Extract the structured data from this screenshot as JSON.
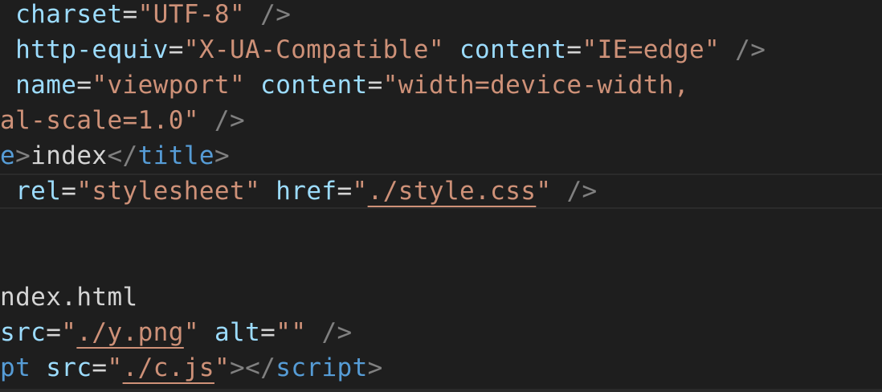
{
  "editor": {
    "lines": [
      [
        {
          "t": " "
        },
        {
          "t": "charset",
          "c": "attr"
        },
        {
          "t": "=",
          "c": "txt"
        },
        {
          "t": "\"UTF-8\"",
          "c": "str"
        },
        {
          "t": " "
        },
        {
          "t": "/>",
          "c": "punc"
        }
      ],
      [
        {
          "t": " "
        },
        {
          "t": "http-equiv",
          "c": "attr"
        },
        {
          "t": "=",
          "c": "txt"
        },
        {
          "t": "\"X-UA-Compatible\"",
          "c": "str"
        },
        {
          "t": " "
        },
        {
          "t": "content",
          "c": "attr"
        },
        {
          "t": "=",
          "c": "txt"
        },
        {
          "t": "\"IE=edge\"",
          "c": "str"
        },
        {
          "t": " "
        },
        {
          "t": "/>",
          "c": "punc"
        }
      ],
      [
        {
          "t": " "
        },
        {
          "t": "name",
          "c": "attr"
        },
        {
          "t": "=",
          "c": "txt"
        },
        {
          "t": "\"viewport\"",
          "c": "str"
        },
        {
          "t": " "
        },
        {
          "t": "content",
          "c": "attr"
        },
        {
          "t": "=",
          "c": "txt"
        },
        {
          "t": "\"width=device-width,",
          "c": "str"
        }
      ],
      [
        {
          "t": "al-scale=1.0\"",
          "c": "str"
        },
        {
          "t": " "
        },
        {
          "t": "/>",
          "c": "punc"
        }
      ],
      [
        {
          "t": "e",
          "c": "tag"
        },
        {
          "t": ">",
          "c": "punc"
        },
        {
          "t": "index",
          "c": "txt"
        },
        {
          "t": "</",
          "c": "punc"
        },
        {
          "t": "title",
          "c": "tag"
        },
        {
          "t": ">",
          "c": "punc"
        }
      ],
      [
        {
          "t": " "
        },
        {
          "t": "rel",
          "c": "attr"
        },
        {
          "t": "=",
          "c": "txt"
        },
        {
          "t": "\"stylesheet\"",
          "c": "str"
        },
        {
          "t": " "
        },
        {
          "t": "href",
          "c": "attr"
        },
        {
          "t": "=",
          "c": "txt"
        },
        {
          "t": "\"",
          "c": "str"
        },
        {
          "t": "./style.css",
          "c": "str",
          "link": true
        },
        {
          "t": "\"",
          "c": "str"
        },
        {
          "t": " "
        },
        {
          "t": "/>",
          "c": "punc"
        }
      ],
      [],
      [],
      [
        {
          "t": "ndex.html",
          "c": "txt"
        }
      ],
      [
        {
          "t": "src",
          "c": "attr"
        },
        {
          "t": "=",
          "c": "txt"
        },
        {
          "t": "\"",
          "c": "str"
        },
        {
          "t": "./y.png",
          "c": "str",
          "link": true
        },
        {
          "t": "\"",
          "c": "str"
        },
        {
          "t": " "
        },
        {
          "t": "alt",
          "c": "attr"
        },
        {
          "t": "=",
          "c": "txt"
        },
        {
          "t": "\"\"",
          "c": "str"
        },
        {
          "t": " "
        },
        {
          "t": "/>",
          "c": "punc"
        }
      ],
      [
        {
          "t": "pt",
          "c": "tag"
        },
        {
          "t": " "
        },
        {
          "t": "src",
          "c": "attr"
        },
        {
          "t": "=",
          "c": "txt"
        },
        {
          "t": "\"",
          "c": "str"
        },
        {
          "t": "./c.js",
          "c": "str",
          "link": true
        },
        {
          "t": "\"",
          "c": "str"
        },
        {
          "t": "></",
          "c": "punc"
        },
        {
          "t": "script",
          "c": "tag"
        },
        {
          "t": ">",
          "c": "punc"
        }
      ]
    ]
  }
}
